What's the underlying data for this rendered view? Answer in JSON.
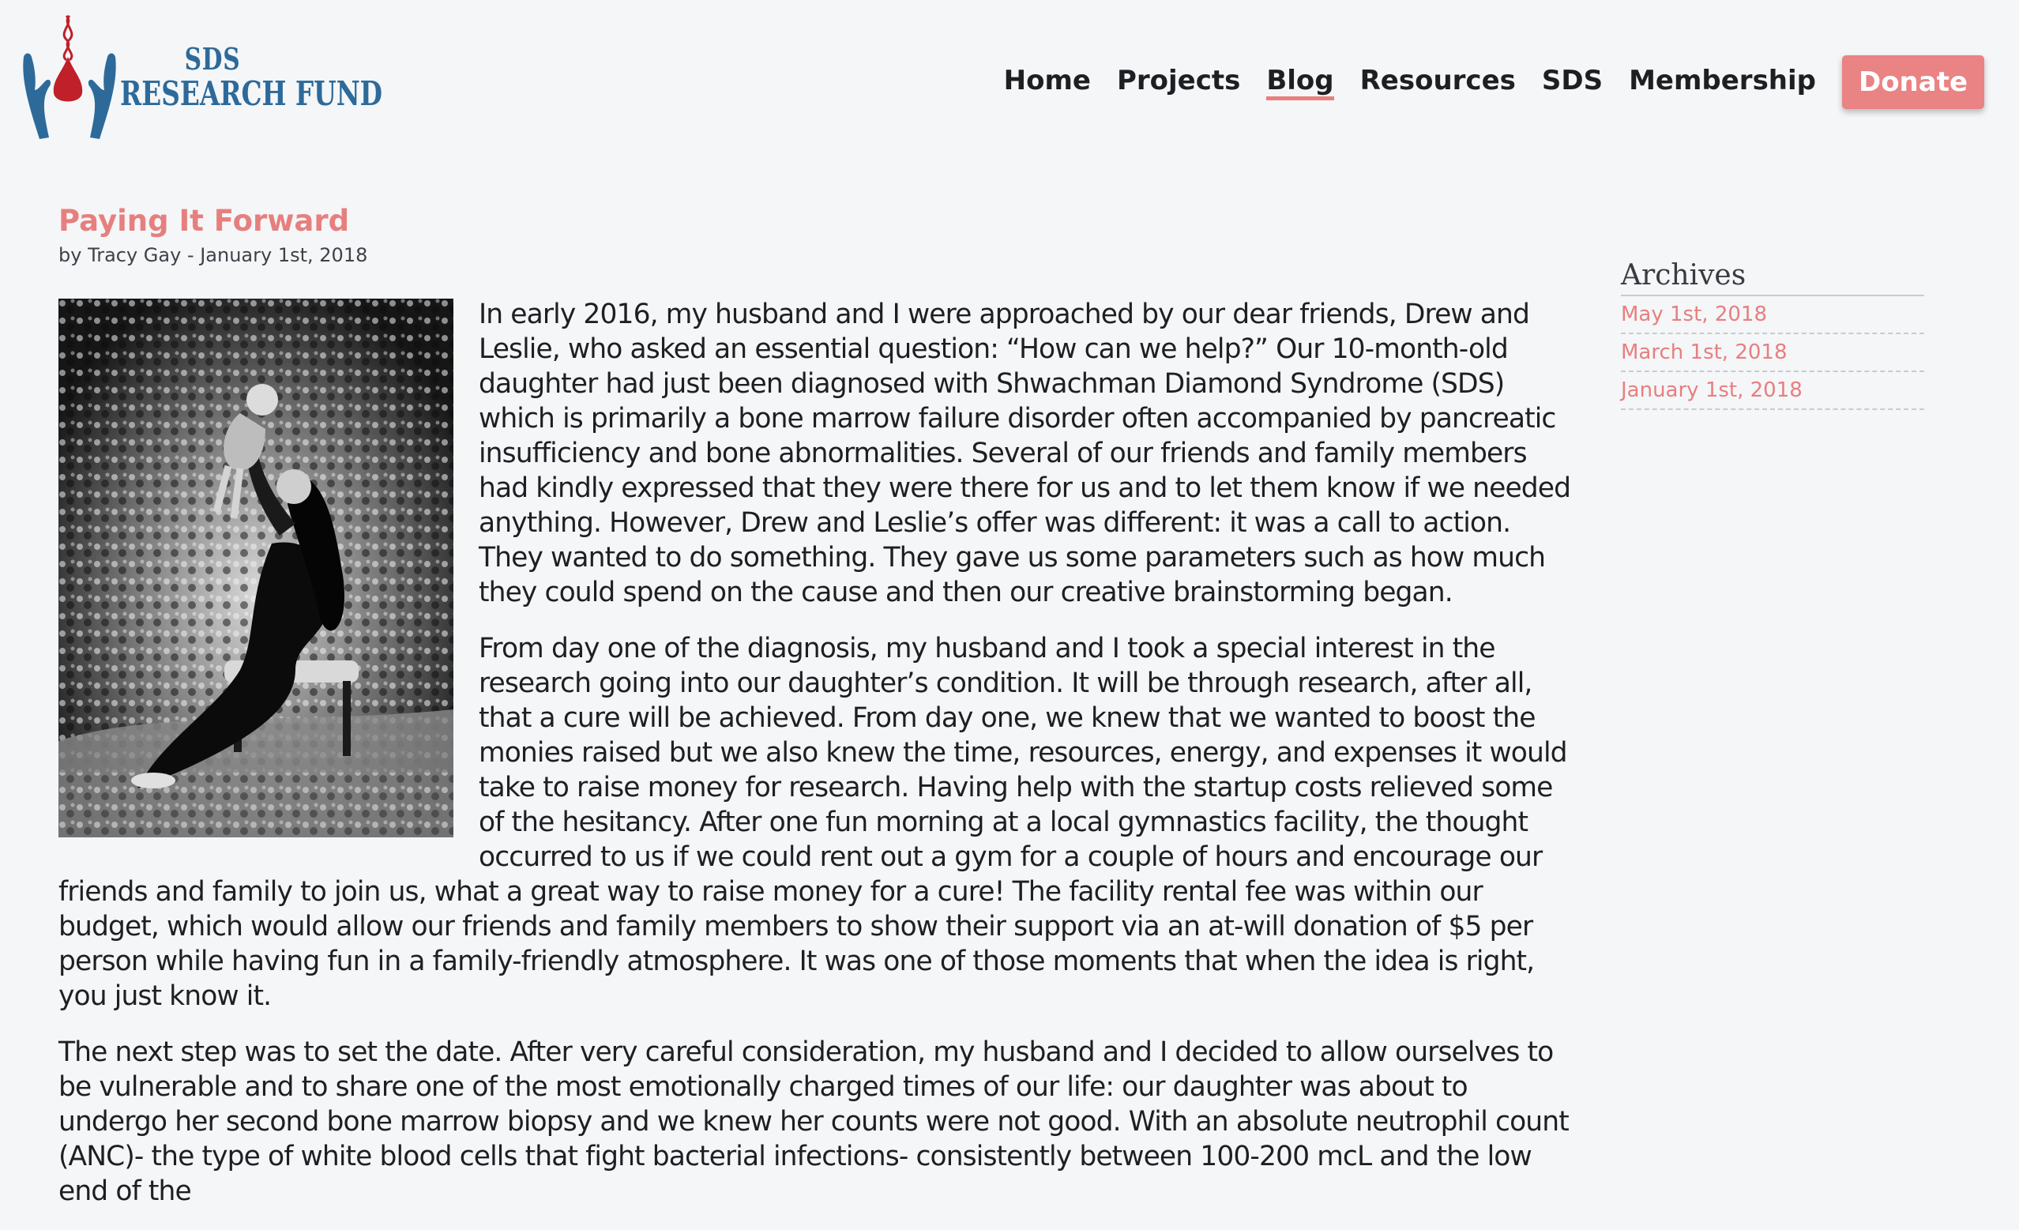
{
  "site": {
    "logo_line1": "SDS",
    "logo_line2": "RESEARCH FUND"
  },
  "nav": {
    "items": [
      {
        "label": "Home"
      },
      {
        "label": "Projects"
      },
      {
        "label": "Blog",
        "active": true
      },
      {
        "label": "Resources"
      },
      {
        "label": "SDS"
      },
      {
        "label": "Membership"
      }
    ],
    "donate_label": "Donate"
  },
  "post": {
    "title": "Paying It Forward",
    "byline": "by Tracy Gay - January 1st, 2018",
    "paragraphs": [
      "In early 2016, my husband and I were approached by our dear friends, Drew and Leslie, who asked an essential question: “How can we help?” Our 10-month-old daughter had just been diagnosed with Shwachman Diamond Syndrome (SDS) which is primarily a bone marrow failure disorder often accompanied by pancreatic insufficiency and bone abnormalities. Several of our friends and family members had kindly expressed that they were there for us and to let them know if we needed anything. However, Drew and Leslie’s offer was different: it was a call to action. They wanted to do something. They gave us some parameters such as how much they could spend on the cause and then our creative brainstorming began.",
      "From day one of the diagnosis, my husband and I took a special interest in the research going into our daughter’s condition. It will be through research, after all, that a cure will be achieved. From day one, we knew that we wanted to boost the monies raised but we also knew the time, resources, energy, and expenses it would take to raise money for research. Having help with the startup costs relieved some of the hesitancy. After one fun morning at a local gymnastics facility, the thought occurred to us if we could rent out a gym for a couple of hours and encourage our friends and family to join us, what a great way to raise money for a cure! The facility rental fee was within our budget, which would allow our friends and family members to show their support via an at-will donation of $5 per person while having fun in a family-friendly atmosphere. It was one of those moments that when the idea is right, you just know it.",
      "The next step was to set the date. After very careful consideration, my husband and I decided to allow ourselves to be vulnerable and to share one of the most emotionally charged times of our life: our daughter was about to undergo her second bone marrow biopsy and we knew her counts were not good. With an absolute neutrophil count (ANC)- the type of white blood cells that fight bacterial infections- consistently between 100-200 mcL and the low end of the"
    ]
  },
  "sidebar": {
    "title": "Archives",
    "links": [
      {
        "label": "May 1st, 2018"
      },
      {
        "label": "March 1st, 2018"
      },
      {
        "label": "January 1st, 2018"
      }
    ]
  },
  "colors": {
    "accent": "#e77f7f",
    "logo_blue": "#2d6a9a",
    "logo_red": "#c0202a",
    "background": "#f4f6f8",
    "text": "#1e1f23"
  }
}
